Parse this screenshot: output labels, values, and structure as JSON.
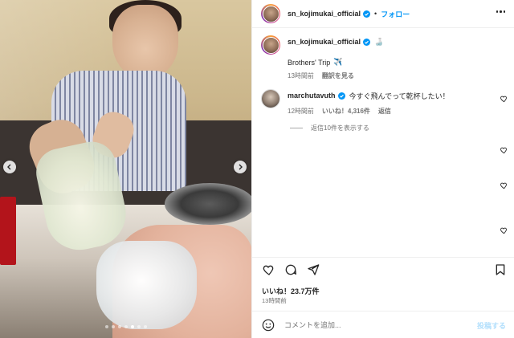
{
  "photo": {
    "prev_icon": "chevron-left-icon",
    "next_icon": "chevron-right-icon",
    "carousel_count": 7,
    "carousel_active": 4
  },
  "header": {
    "username": "sn_kojimukai_official",
    "separator": "•",
    "follow_label": "フォロー",
    "more_icon": "more-horizontal-icon"
  },
  "caption": {
    "username": "sn_kojimukai_official",
    "emoji_after_name": "🍶",
    "text": "Brothers' Trip",
    "text_emoji": "✈️",
    "time": "13時間前",
    "translate_label": "翻訳を見る"
  },
  "comment": {
    "username": "marchutavuth",
    "text": "今すぐ飛んでって乾杯したい！",
    "time": "12時間前",
    "likes": "いいね！4,316件",
    "reply_label": "返信",
    "view_replies": "返信10件を表示する"
  },
  "actions": {
    "like_icon": "heart-icon",
    "comment_icon": "comment-icon",
    "share_icon": "send-icon",
    "save_icon": "bookmark-icon",
    "likes_text": "いいね！23.7万件",
    "time": "13時間前"
  },
  "compose": {
    "emoji_icon": "smiley-icon",
    "placeholder": "コメントを追加...",
    "post_label": "投稿する"
  },
  "colors": {
    "accent": "#0095f6",
    "verified": "#0095f6",
    "muted": "#737373",
    "post_disabled": "#b2dffc"
  }
}
